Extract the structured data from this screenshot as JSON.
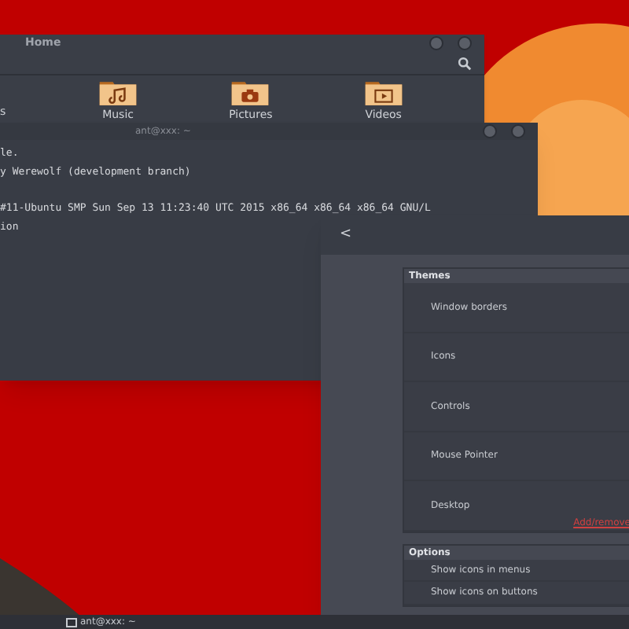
{
  "file_manager": {
    "title": "Home",
    "folders": [
      {
        "label": "s"
      },
      {
        "label": "Music",
        "kind": "music"
      },
      {
        "label": "Pictures",
        "kind": "pictures"
      },
      {
        "label": "Videos",
        "kind": "videos"
      }
    ]
  },
  "terminal": {
    "title": "ant@xxx: ~",
    "lines": [
      {
        "text": "le.",
        "gap_before": false
      },
      {
        "text": "y Werewolf (development branch)",
        "gap_before": false
      },
      {
        "text": "#11-Ubuntu SMP Sun Sep 13 11:23:40 UTC 2015 x86_64 x86_64 x86_64 GNU/L",
        "gap_before": true
      },
      {
        "text": "ion",
        "gap_before": false
      }
    ]
  },
  "settings": {
    "back": "<",
    "sections": [
      {
        "title": "Themes",
        "rows": [
          "Window borders",
          "Icons",
          "Controls",
          "Mouse Pointer",
          "Desktop"
        ],
        "link": "Add/remove"
      },
      {
        "title": "Options",
        "rows": [
          "Show icons in menus",
          "Show icons on buttons"
        ]
      }
    ]
  },
  "taskbar": {
    "items": [
      {
        "label": "ant@xxx: ~"
      }
    ]
  }
}
